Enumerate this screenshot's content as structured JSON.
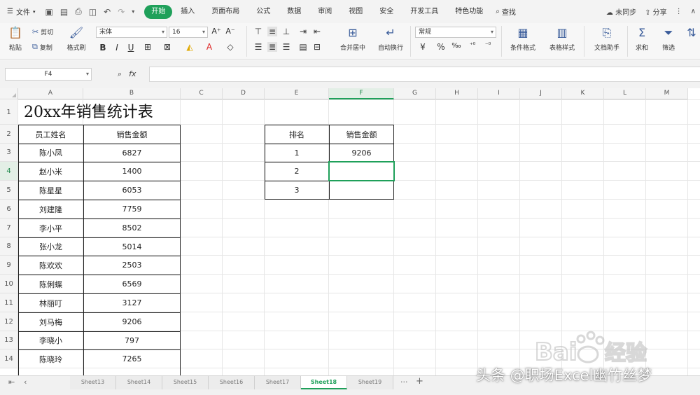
{
  "menu": {
    "file_label": "文件",
    "tabs": [
      "开始",
      "插入",
      "页面布局",
      "公式",
      "数据",
      "审阅",
      "视图",
      "安全",
      "开发工具",
      "特色功能"
    ],
    "active_tab_index": 0,
    "search_label": "查找",
    "right": {
      "sync_label": "未同步",
      "share_label": "分享"
    }
  },
  "ribbon": {
    "paste": "粘贴",
    "cut": "剪切",
    "copy": "复制",
    "format_painter": "格式刷",
    "font_name": "宋体",
    "font_size": "16",
    "merge_center": "合并居中",
    "auto_wrap": "自动换行",
    "number_format": "常规",
    "cond_format": "条件格式",
    "table_style": "表格样式",
    "doc_helper": "文档助手",
    "sum": "求和",
    "filter": "筛选"
  },
  "formula_bar": {
    "name_box": "F4",
    "fx_label": "fx",
    "value": ""
  },
  "grid": {
    "columns": [
      "A",
      "B",
      "C",
      "D",
      "E",
      "F",
      "G",
      "H",
      "I",
      "J",
      "K",
      "L",
      "M"
    ],
    "rows": [
      "1",
      "2",
      "3",
      "4",
      "5",
      "6",
      "7",
      "8",
      "9",
      "10",
      "11",
      "12",
      "13",
      "14"
    ],
    "active_column": "F",
    "active_row": "4",
    "title": "20xx年销售统计表",
    "headers": {
      "name": "员工姓名",
      "amount": "销售金额"
    },
    "records": [
      {
        "name": "陈小凤",
        "amount": "6827"
      },
      {
        "name": "赵小米",
        "amount": "1400"
      },
      {
        "name": "陈星星",
        "amount": "6053"
      },
      {
        "name": "刘建隆",
        "amount": "7759"
      },
      {
        "name": "李小平",
        "amount": "8502"
      },
      {
        "name": "张小龙",
        "amount": "5014"
      },
      {
        "name": "陈欢欢",
        "amount": "2503"
      },
      {
        "name": "陈俐蝶",
        "amount": "6569"
      },
      {
        "name": "林丽叮",
        "amount": "3127"
      },
      {
        "name": "刘马梅",
        "amount": "9206"
      },
      {
        "name": "李晓小",
        "amount": "797"
      },
      {
        "name": "陈晓玲",
        "amount": "7265"
      }
    ],
    "rank_table": {
      "headers": {
        "rank": "排名",
        "amount": "销售金额"
      },
      "rows": [
        {
          "rank": "1",
          "amount": "9206"
        },
        {
          "rank": "2",
          "amount": ""
        },
        {
          "rank": "3",
          "amount": ""
        }
      ]
    }
  },
  "sheets": {
    "tabs": [
      "Sheet13",
      "Sheet14",
      "Sheet15",
      "Sheet16",
      "Sheet17",
      "Sheet18",
      "Sheet19"
    ],
    "active_index": 5,
    "more": "···",
    "add": "+"
  },
  "watermarks": {
    "baidu": "Bai",
    "baidu_cn": "经验",
    "toutiao": "头条 @职场Excel幽竹丝梦"
  },
  "colors": {
    "accent": "#1fa05a",
    "grid_line": "#e6e6e6",
    "header_bg": "#f4f4f4"
  }
}
